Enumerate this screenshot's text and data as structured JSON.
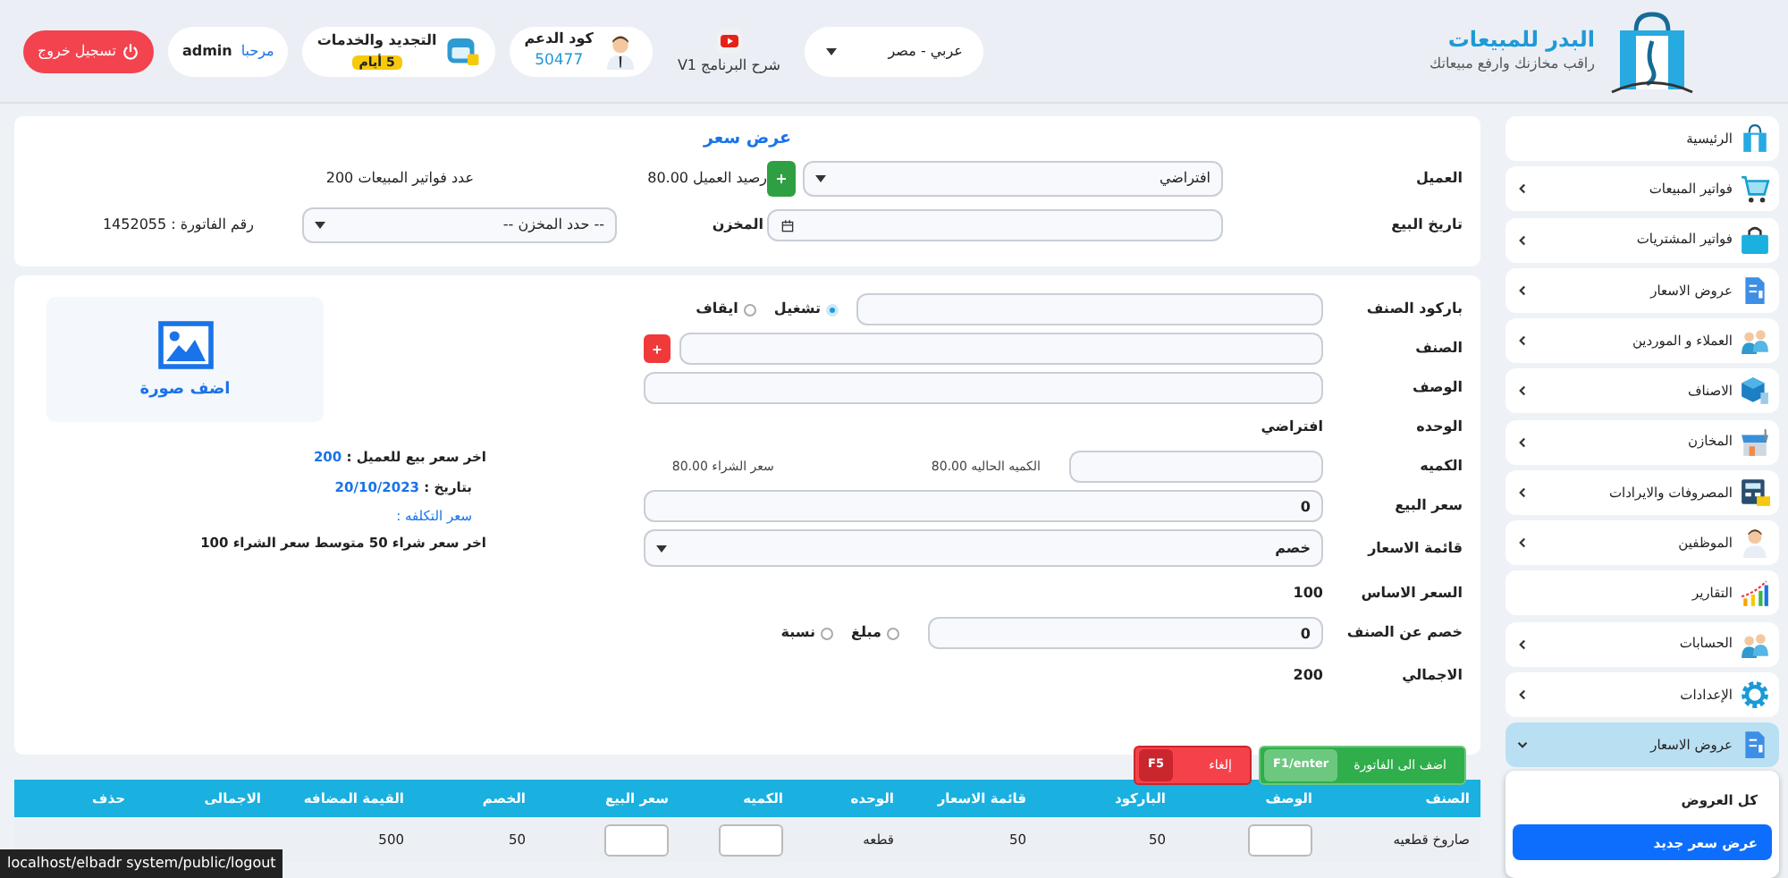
{
  "header": {
    "brand": {
      "title": "البدر للمبيعات",
      "tagline": "راقب مخازنك وارفع مبيعاتك"
    },
    "language_select": "عربي - مصر",
    "tutorial": "شرح البرنامج V1",
    "support": {
      "label": "كود الدعم",
      "code": "50477"
    },
    "renewal": {
      "label": "التجديد والخدمات",
      "badge": "5 أيام"
    },
    "welcome": {
      "greeting": "مرحبا",
      "user": "admin"
    },
    "logout": "تسجيل خروج"
  },
  "sidebar": {
    "items": [
      {
        "label": "الرئيسية",
        "has_children": false,
        "expanded": false
      },
      {
        "label": "فواتير المبيعات",
        "has_children": true,
        "expanded": false
      },
      {
        "label": "فواتير المشتريات",
        "has_children": true,
        "expanded": false
      },
      {
        "label": "عروض الاسعار",
        "has_children": true,
        "expanded": false
      },
      {
        "label": "العملاء و الموردين",
        "has_children": true,
        "expanded": false
      },
      {
        "label": "الاصناف",
        "has_children": true,
        "expanded": false
      },
      {
        "label": "المخازن",
        "has_children": true,
        "expanded": false
      },
      {
        "label": "المصروفات والايرادات",
        "has_children": true,
        "expanded": false
      },
      {
        "label": "الموظفين",
        "has_children": true,
        "expanded": false
      },
      {
        "label": "التقارير",
        "has_children": false,
        "expanded": false
      },
      {
        "label": "الحسابات",
        "has_children": true,
        "expanded": false
      },
      {
        "label": "الإعدادات",
        "has_children": true,
        "expanded": false
      },
      {
        "label": "عروض الاسعار",
        "has_children": true,
        "expanded": true,
        "children": [
          {
            "label": "كل العروض",
            "selected": false
          },
          {
            "label": "عرض سعر جديد",
            "selected": true
          }
        ]
      }
    ]
  },
  "quote": {
    "title": "عرض سعر",
    "customer": {
      "label": "العميل",
      "value": "افتراضي"
    },
    "customer_balance": "رصيد العميل 80.00",
    "sales_invoices_count": "عدد فواتير المبيعات 200",
    "sale_date": {
      "label": "تاريخ البيع"
    },
    "warehouse": {
      "label": "المخزن",
      "value": "-- حدد المخزن --"
    },
    "invoice_number": "رقم الفاتورة : 1452055"
  },
  "item_form": {
    "barcode": {
      "label": "باركود الصنف"
    },
    "scan_mode": [
      {
        "label": "تشغيل",
        "selected": true
      },
      {
        "label": "ايقاف",
        "selected": false
      }
    ],
    "item": {
      "label": "الصنف"
    },
    "description": {
      "label": "الوصف"
    },
    "unit": {
      "label": "الوحده",
      "value": "افتراضي"
    },
    "quantity": {
      "label": "الكميه"
    },
    "current_quantity": "الكميه الحاليه 80.00",
    "purchase_price": "سعر الشراء 80.00",
    "sale_price": {
      "label": "سعر البيع",
      "value": "0"
    },
    "price_list": {
      "label": "قائمة الاسعار",
      "value": "خصم"
    },
    "base_price": {
      "label": "السعر الاساس",
      "value": "100"
    },
    "item_discount": {
      "label": "خصم عن الصنف",
      "value": "0"
    },
    "discount_type": [
      {
        "label": "مبلغ",
        "selected": false
      },
      {
        "label": "نسبة",
        "selected": false
      }
    ],
    "total": {
      "label": "الاجمالي",
      "value": "200"
    },
    "add_image": "اضف صورة",
    "last_sale_price": {
      "label": "اخر سعر بيع للعميل :",
      "value": "200"
    },
    "last_sale_date": {
      "label": "بتاريخ :",
      "value": "20/10/2023"
    },
    "cost_price": "سعر التكلفه :",
    "purchase_summary": "اخر سعر شراء 50 متوسط سعر الشراء 100",
    "buttons": [
      {
        "label": "اضف الى الفاتورة",
        "shortcut": "F1/enter",
        "kind": "add"
      },
      {
        "label": "إلغاء",
        "shortcut": "F5",
        "kind": "cancel"
      }
    ]
  },
  "table": {
    "columns": [
      "الصنف",
      "الوصف",
      "الباركود",
      "قائمة الاسعار",
      "الوحده",
      "الكميه",
      "سعر البيع",
      "الخصم",
      "القيمة المضافه",
      "الاجمالى",
      "حذف"
    ],
    "rows": [
      {
        "cells": [
          {
            "kind": "text",
            "text": "صاروخ قطعيه"
          },
          {
            "kind": "input"
          },
          {
            "kind": "text",
            "text": "50"
          },
          {
            "kind": "text",
            "text": "50"
          },
          {
            "kind": "text",
            "text": "قطعه"
          },
          {
            "kind": "input"
          },
          {
            "kind": "input"
          },
          {
            "kind": "text",
            "text": "50"
          },
          {
            "kind": "text",
            "text": "500"
          }
        ]
      }
    ]
  },
  "status_url": "localhost/elbadr system/public/logout"
}
